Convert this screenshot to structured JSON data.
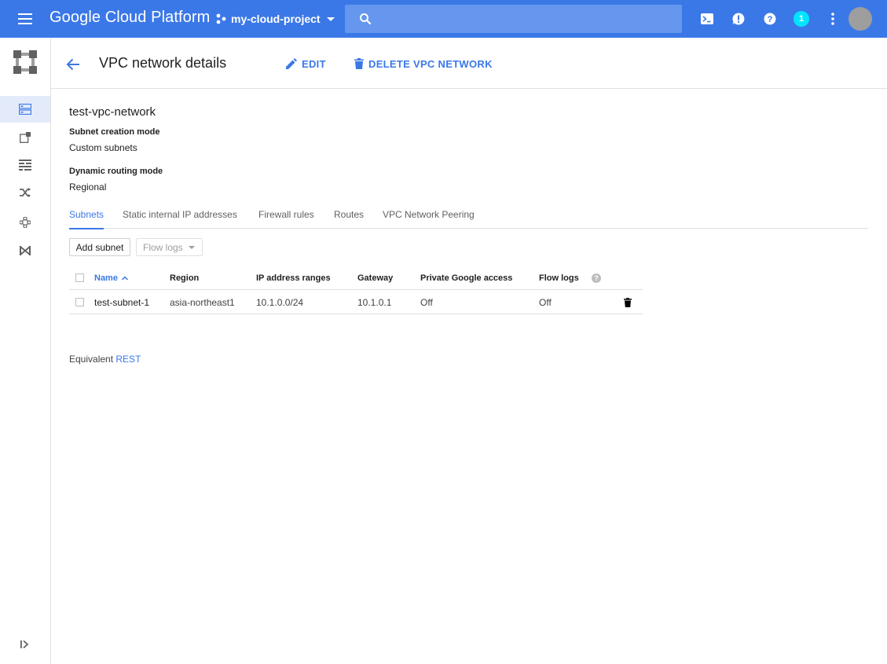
{
  "topbar": {
    "brand": "Google Cloud Platform",
    "project_name": "my-cloud-project",
    "search_placeholder": "",
    "notification_count": "1"
  },
  "header": {
    "title": "VPC network details",
    "edit_label": "EDIT",
    "delete_label": "DELETE VPC NETWORK"
  },
  "network": {
    "name": "test-vpc-network",
    "subnet_mode_label": "Subnet creation mode",
    "subnet_mode_value": "Custom subnets",
    "routing_mode_label": "Dynamic routing mode",
    "routing_mode_value": "Regional"
  },
  "tabs": [
    {
      "label": "Subnets"
    },
    {
      "label": "Static internal IP addresses"
    },
    {
      "label": "Firewall rules"
    },
    {
      "label": "Routes"
    },
    {
      "label": "VPC Network Peering"
    }
  ],
  "toolbar": {
    "add_subnet_label": "Add subnet",
    "flow_logs_label": "Flow logs"
  },
  "table": {
    "columns": [
      "Name",
      "Region",
      "IP address ranges",
      "Gateway",
      "Private Google access",
      "Flow logs"
    ],
    "rows": [
      {
        "name": "test-subnet-1",
        "region": "asia-northeast1",
        "ip_range": "10.1.0.0/24",
        "gateway": "10.1.0.1",
        "private_access": "Off",
        "flow_logs": "Off"
      }
    ]
  },
  "footer": {
    "equivalent_label": "Equivalent",
    "rest_link": "REST"
  },
  "colors": {
    "topbar": "#3b78e7",
    "accent": "#3b78e7",
    "search_bg": "#6597ee",
    "badge": "#00e5ff"
  },
  "icons": [
    "menu-icon",
    "project-icon",
    "search-icon",
    "cloud-shell-icon",
    "feedback-icon",
    "help-icon",
    "more-vert-icon",
    "back-arrow-icon",
    "edit-pencil-icon",
    "delete-trash-icon",
    "vpc-networks-icon",
    "external-ip-icon",
    "firewall-icon",
    "routes-icon",
    "peering-icon",
    "shared-vpc-icon",
    "expand-rail-icon"
  ]
}
